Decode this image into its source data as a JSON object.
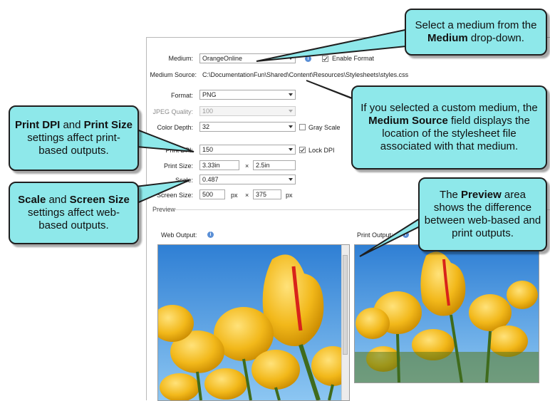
{
  "settings": {
    "medium_label": "Medium:",
    "medium_value": "OrangeOnline",
    "enable_format_label": "Enable Format",
    "medium_source_label": "Medium Source:",
    "medium_source_value": "C:\\DocumentationFun\\Shared\\Content\\Resources\\Stylesheets\\styles.css",
    "format_label": "Format:",
    "format_value": "PNG",
    "jpeg_quality_label": "JPEG Quality:",
    "jpeg_quality_value": "100",
    "color_depth_label": "Color Depth:",
    "color_depth_value": "32",
    "gray_scale_label": "Gray Scale",
    "print_dpi_label": "Print DPI:",
    "print_dpi_value": "150",
    "lock_dpi_label": "Lock DPI",
    "print_size_label": "Print Size:",
    "print_size_w": "3.33in",
    "print_size_x": "×",
    "print_size_h": "2.5in",
    "scale_label": "Scale:",
    "scale_value": "0.487",
    "screen_size_label": "Screen Size:",
    "screen_size_w": "500",
    "screen_size_w_unit": "px",
    "screen_size_x": "×",
    "screen_size_h": "375",
    "screen_size_h_unit": "px"
  },
  "preview": {
    "section_label": "Preview",
    "web_output_label": "Web Output:",
    "print_output_label": "Print Output:"
  },
  "callouts": {
    "medium": [
      "Select a medium from the ",
      "Medium",
      " drop-down."
    ],
    "source": [
      "If you selected a custom medium, the ",
      "Medium Source",
      " field displays the location of the stylesheet file associated with that medium."
    ],
    "print": [
      "Print DPI",
      " and ",
      "Print Size",
      " settings affect print-based outputs."
    ],
    "scale": [
      "Scale",
      " and ",
      "Screen Size",
      " settings affect web-based outputs."
    ],
    "preview": [
      "The ",
      "Preview",
      " area shows the difference between web-based and print outputs."
    ]
  },
  "colors": {
    "callout_fill": "#8ee8ea",
    "sky": "#4a9de0",
    "tulip": "#f2b81a"
  }
}
